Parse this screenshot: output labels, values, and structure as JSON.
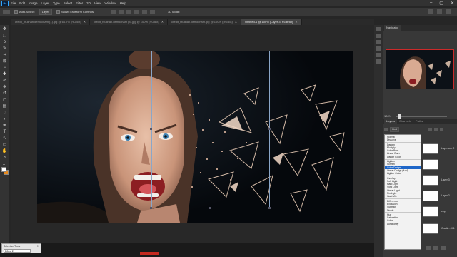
{
  "menubar": {
    "app_icon": "Ps",
    "items": [
      "File",
      "Edit",
      "Image",
      "Layer",
      "Type",
      "Select",
      "Filter",
      "3D",
      "View",
      "Window",
      "Help"
    ],
    "window_controls": [
      "–",
      "▢",
      "✕"
    ]
  },
  "options": {
    "auto_select": "Auto-Select:",
    "layer_dropdown": "Layer",
    "transform_controls": "Show Transform Controls",
    "three_d_mode": "3D Mode:"
  },
  "tabs": [
    {
      "label": "credit_rituilhan.democham (1).jpg @ 66.7% (RGB/8)",
      "active": false
    },
    {
      "label": "credit_rituilhan.democham (4).jpg @ 100% (RGB/8)",
      "active": false
    },
    {
      "label": "credit_rituilhan.democham.jpg @ 100% (RGB/8)",
      "active": false
    },
    {
      "label": "Untitled-1 @ 100% (Layer 3, RGB/8#)",
      "active": true
    }
  ],
  "tools": [
    "move-tool",
    "marquee-tool",
    "lasso-tool",
    "quick-select-tool",
    "crop-tool",
    "frame-tool",
    "eyedropper-tool",
    "healing-tool",
    "brush-tool",
    "clone-stamp-tool",
    "history-brush-tool",
    "eraser-tool",
    "gradient-tool",
    "blur-tool",
    "dodge-tool",
    "pen-tool",
    "type-tool",
    "path-select-tool",
    "shape-tool",
    "hand-tool",
    "zoom-tool",
    "more-tools"
  ],
  "tool_glyphs": [
    "✥",
    "⬚",
    "ↄ",
    "✎",
    "⌗",
    "⊠",
    "⌐",
    "✚",
    "✐",
    "⎈",
    "↺",
    "◻",
    "▤",
    "◌",
    "◐",
    "✒",
    "T",
    "↖",
    "▭",
    "✋",
    "⌕",
    "…"
  ],
  "colors": {
    "foreground": "#ffffff",
    "background": "#e88a1e",
    "accent": "#1e66c8"
  },
  "navigator": {
    "tab": "Navigator",
    "zoom": "100%"
  },
  "layers_panel": {
    "tabs": [
      "Layers",
      "Channels",
      "Paths"
    ],
    "kind_label": "Kind",
    "layers": [
      {
        "name": "Layer cop 2"
      },
      {
        "name": ""
      },
      {
        "name": "Layer 3"
      },
      {
        "name": "Layer 2"
      },
      {
        "name": "copy"
      },
      {
        "name": "Gradie...ill 1"
      }
    ]
  },
  "blend_modes": {
    "groups": [
      [
        "Normal",
        "Dissolve"
      ],
      [
        "Darken",
        "Multiply",
        "Color Burn",
        "Linear Burn",
        "Darker Color"
      ],
      [
        "Lighten",
        "Screen",
        "Color Dodge",
        "Linear Dodge (Add)",
        "Lighter Color"
      ],
      [
        "Overlay",
        "Soft Light",
        "Hard Light",
        "Vivid Light",
        "Linear Light",
        "Pin Light",
        "Hard Mix"
      ],
      [
        "Difference",
        "Exclusion",
        "Subtract",
        "Divide"
      ],
      [
        "Hue",
        "Saturation",
        "Color",
        "Luminosity"
      ]
    ],
    "selected": "Color Dodge"
  },
  "status_panel": {
    "title": "Selective Tools",
    "field": "Dflow 2"
  }
}
